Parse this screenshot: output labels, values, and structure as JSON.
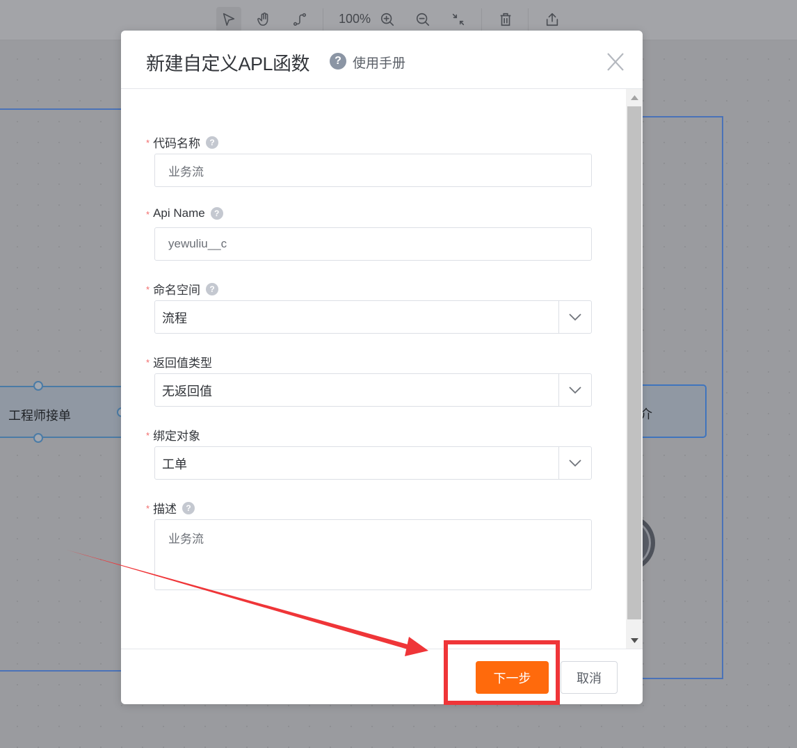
{
  "toolbar": {
    "tools": [
      {
        "name": "select-tool",
        "icon": "pointer-icon",
        "active": true
      },
      {
        "name": "pan-tool",
        "icon": "hand-icon",
        "active": false
      },
      {
        "name": "connector-tool",
        "icon": "connector-icon",
        "active": false
      }
    ],
    "zoom_level": "100%",
    "actions": [
      "zoom-in-icon",
      "zoom-out-icon",
      "fit-icon",
      "trash-icon",
      "export-icon"
    ]
  },
  "canvas": {
    "nodes": [
      {
        "label": "工程师接单"
      },
      {
        "label": "介"
      }
    ]
  },
  "modal": {
    "title": "新建自定义APL函数",
    "help_label": "使用手册",
    "help_icon": "?",
    "fields": [
      {
        "label": "代码名称",
        "required": true,
        "has_help": true,
        "type": "text",
        "value": "业务流"
      },
      {
        "label": "Api Name",
        "required": true,
        "has_help": true,
        "type": "text",
        "value": "yewuliu__c"
      },
      {
        "label": "命名空间",
        "required": true,
        "has_help": true,
        "type": "select",
        "value": "流程"
      },
      {
        "label": "返回值类型",
        "required": true,
        "has_help": false,
        "type": "select",
        "value": "无返回值"
      },
      {
        "label": "绑定对象",
        "required": true,
        "has_help": false,
        "type": "select",
        "value": "工单"
      },
      {
        "label": "描述",
        "required": true,
        "has_help": true,
        "type": "textarea",
        "value": "业务流"
      }
    ],
    "required_mark": "*",
    "next_label": "下一步",
    "cancel_label": "取消"
  },
  "colors": {
    "primary": "#ff6a0c",
    "annotation": "#ef3538",
    "required": "#f26b6b"
  }
}
